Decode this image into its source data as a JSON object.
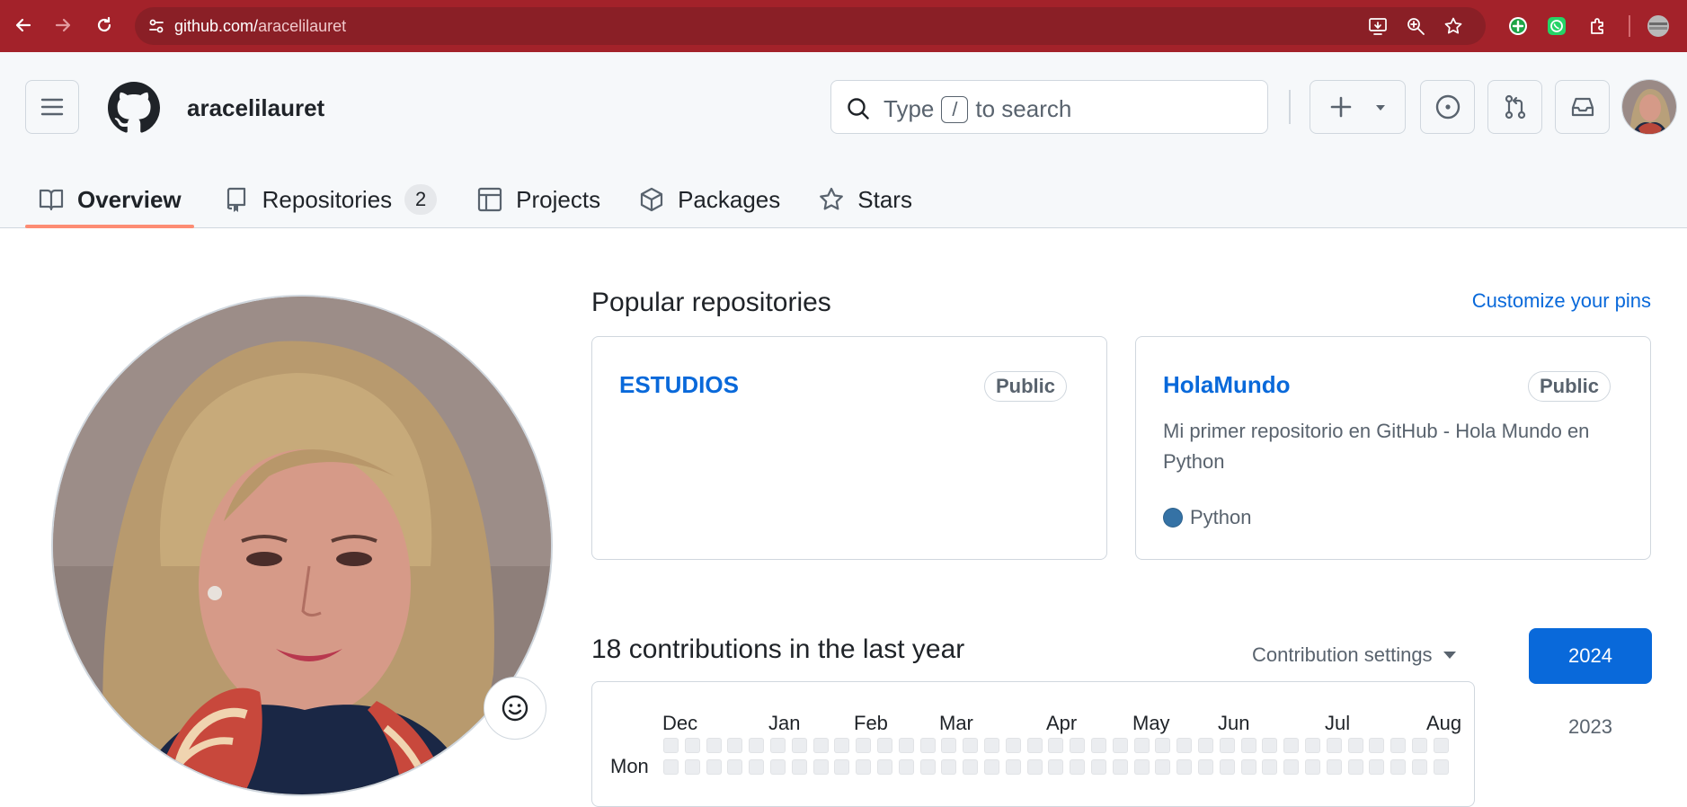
{
  "browser": {
    "url_host": "github.com/",
    "url_path": "aracelilauret"
  },
  "header": {
    "username": "aracelilauret",
    "search_prefix": "Type",
    "search_key": "/",
    "search_suffix": "to search"
  },
  "tabs": [
    {
      "label": "Overview",
      "icon": "book-icon"
    },
    {
      "label": "Repositories",
      "icon": "repo-icon",
      "count": "2"
    },
    {
      "label": "Projects",
      "icon": "table-icon"
    },
    {
      "label": "Packages",
      "icon": "package-icon"
    },
    {
      "label": "Stars",
      "icon": "star-icon"
    }
  ],
  "popular": {
    "title": "Popular repositories",
    "customize": "Customize your pins",
    "repos": [
      {
        "name": "ESTUDIOS",
        "visibility": "Public",
        "description": "",
        "language": ""
      },
      {
        "name": "HolaMundo",
        "visibility": "Public",
        "description": "Mi primer repositorio en GitHub - Hola Mundo en Python",
        "language": "Python",
        "language_color": "#3572A5"
      }
    ]
  },
  "contributions": {
    "title": "18 contributions in the last year",
    "settings": "Contribution settings",
    "years": [
      "2024",
      "2023"
    ],
    "months": [
      "Dec",
      "Jan",
      "Feb",
      "Mar",
      "Apr",
      "May",
      "Jun",
      "Jul",
      "Aug"
    ],
    "day_label": "Mon"
  },
  "colors": {
    "accent": "#0969da",
    "chrome": "#a3222a",
    "tab_underline": "#fd8c73"
  }
}
